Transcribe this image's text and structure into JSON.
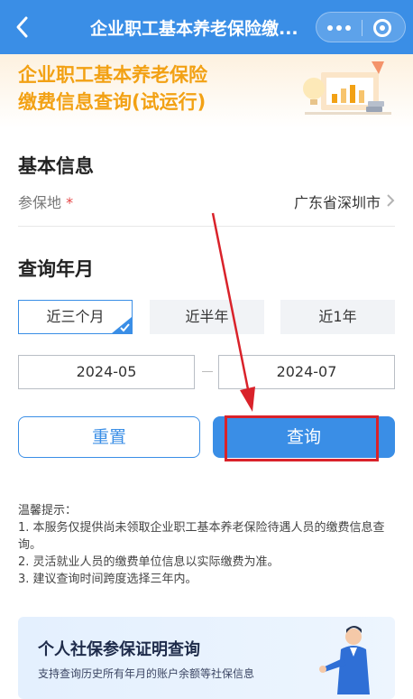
{
  "header": {
    "title": "企业职工基本养老保险缴...",
    "back_icon": "chevron-left-icon",
    "more_icon": "more-dots-icon",
    "close_icon": "target-close-icon"
  },
  "banner": {
    "line1": "企业职工基本养老保险",
    "line2": "缴费信息查询(试运行)"
  },
  "basic_info": {
    "title": "基本信息",
    "location_label": "参保地",
    "required_mark": "*",
    "location_value": "广东省深圳市"
  },
  "period": {
    "title": "查询年月",
    "options": [
      "近三个月",
      "近半年",
      "近1年"
    ],
    "selected": "近三个月",
    "start": "2024-05",
    "end": "2024-07"
  },
  "buttons": {
    "reset": "重置",
    "query": "查询"
  },
  "tips": {
    "title": "温馨提示：",
    "lines": [
      "1. 本服务仅提供尚未领取企业职工基本养老保险待遇人员的缴费信息查询。",
      "2. 灵活就业人员的缴费单位信息以实际缴费为准。",
      "3. 建议查询时间跨度选择三年内。"
    ]
  },
  "card": {
    "title": "个人社保参保证明查询",
    "subtitle": "支持查询历史所有年月的账户余额等社保信息"
  },
  "colors": {
    "primary": "#3a8ee6",
    "banner_text": "#f2a114",
    "annotation_red": "#d9222a"
  }
}
